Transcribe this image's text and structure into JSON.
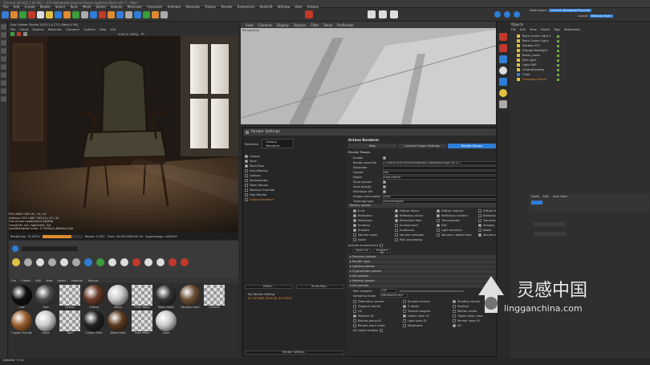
{
  "window": {
    "title": "Cinema 4D S22.118 (RC) - [03 Hollywood Inspired Boom Lighting Start.c4d *] - Main"
  },
  "menus": [
    "File",
    "Edit",
    "Create",
    "Modes",
    "Select",
    "Tools",
    "Mesh",
    "Spline",
    "Volume",
    "MoGraph",
    "Character",
    "Animate",
    "Simulate",
    "Tracker",
    "Render",
    "Extensions",
    "Redshift",
    "Window",
    "Help",
    "Octane"
  ],
  "node_space": {
    "label": "Node Space:",
    "value": "Current (Standard/Physical)",
    "layout_label": "Layout:",
    "layout_value": "Startup (User)"
  },
  "live_viewer": {
    "title": "Live Viewer Studio 2020.1.4 [T.O.-Beta 4 PA]",
    "menus": [
      "File",
      "Cloud",
      "Objects",
      "Materials",
      "Compare",
      "Options",
      "Help",
      "GUI"
    ],
    "zoom": "1:00 (S 100%)",
    "channel": "PT"
  },
  "render_stats": {
    "lines": [
      "RTX 2080 Ti/PCI-E | 74 | 53",
      "GeForce GTX 1080 Ti/PCI-E | 57 | 51",
      "Out-of-core used/max:0 kb/4Gb",
      "Grey8/16: 0/0 | Rgb32/64: 0/4",
      "Used/free/total vram: 4.732Gb/5.464Gb/11Gb"
    ],
    "bar": "Rendering: 73.437% Ms/sec: 5.951 Time: 00 : 00 : 25/00 : 00 : 34 Spp/maxspp: 160/320 Tri: 263/571 Mesh: 1/10 Hair: 0",
    "bar_values": [
      "Rendering: 73.437%",
      "Ms/sec: 5.951",
      "Time: 00:00:25/00:00:34",
      "Spp/maxspp: 160/320"
    ]
  },
  "material_manager": {
    "menus": [
      "File",
      "Create",
      "Edit",
      "View",
      "Select",
      "Material",
      "Texture"
    ],
    "materials": [
      "Leaf",
      "Wall",
      "Octane",
      "Ceiling",
      "Metal",
      "Floor Wood",
      "Black Metal",
      "Wooden Floor",
      "Chrome",
      "Copper Handle",
      "Glass",
      "Wall",
      "Carbon Fiber",
      "Wood Fiber",
      "Floor Metal",
      "Loon"
    ]
  },
  "viewport": {
    "menus": [
      "View",
      "Cameras",
      "Display",
      "Options",
      "Filter",
      "Panel",
      "ProRender"
    ],
    "label": "Perspective"
  },
  "render_settings": {
    "title": "Render Settings",
    "renderer_label": "Renderer",
    "renderer_value": "Octane Renderer",
    "left_items": [
      "Output",
      "Save",
      "Multi-Pass",
      "Anti-Aliasing",
      "Options",
      "Stereoscopic",
      "Team Render",
      "Material Override",
      "Hair Render",
      "Octane Renderer"
    ],
    "effect_button": "Effect...",
    "multipass_button": "Multi-Pass...",
    "preset_items": [
      "My Render Setting",
      "04 OCTANE (RGB 4K GLX PSD)"
    ],
    "render_setting_button": "Render Setting...",
    "heading": "Octane Renderer",
    "tabs": [
      "Main",
      "Camera Imager Settings",
      "Render Passes"
    ],
    "section": "Render Passes",
    "fields": [
      {
        "label": "Enable",
        "checked": true
      },
      {
        "label": "Render pass file",
        "value": "C:\\Users\\Ortiz\\OneDrive\\Desktop\\Cube\\Walkthrough 4K\\ 0\\ 1"
      },
      {
        "label": "Separator",
        "value": ""
      },
      {
        "label": "Format",
        "value": "PNG"
      },
      {
        "label": "Depth",
        "value": "8 bit/Channel"
      },
      {
        "label": "Show passes",
        "checked": true
      },
      {
        "label": "Save beauty",
        "checked": true
      },
      {
        "label": "Multilayer file",
        "checked": true
      },
      {
        "label": "Image color profile",
        "value": "sRGB"
      },
      {
        "label": "Tonemap type",
        "value": "Untonemapped"
      }
    ],
    "subsection": "Beauty passes",
    "beauty_passes": [
      [
        "Emit",
        "Diffuse direct",
        "Diffuse indirect",
        "Diffuse filter"
      ],
      [
        "Reflection",
        "Reflection direct",
        "Reflection indirect",
        "Reflection filter"
      ],
      [
        "Refraction",
        "Refraction filter",
        "Transmission",
        "Transmission filter"
      ],
      [
        "Emitters",
        "Environment",
        "SSS",
        "Shadow"
      ],
      [
        "Shadow",
        "Irradiance",
        "Light direction",
        "Noise"
      ],
      [
        "Volume mask",
        "Volume emission",
        "Volume z-depth front",
        "Volume z-depth back"
      ],
      [
        "Noise",
        "Post processing"
      ]
    ],
    "include_env": "Include environment",
    "select_all": "Select All",
    "deselect_all": "Deselect All",
    "collapsed": [
      "Denoiser passes",
      "Render layer",
      "Lighting passes",
      "Cryptomatte passes",
      "Info passes",
      "Material passes"
    ],
    "info_header": "Info passes",
    "max_samples_label": "Max samples",
    "max_samples_value": "128",
    "sampling_mode_label": "Sampling mode",
    "sampling_mode_value": "Distributed rays",
    "info_passes": [
      [
        "Geometric normal",
        "Smooth normal",
        "Shading normal"
      ],
      [
        "Tangent normal",
        "Z-depth",
        "Position"
      ],
      [
        "UV",
        "Texture tangent",
        "Motion vector"
      ],
      [
        "Material ID",
        "Object layer ID",
        "Object layer color"
      ],
      [
        "Baking group ID",
        "Light pass ID",
        "Render layer ID"
      ],
      [
        "Render layer mask",
        "Wireframe",
        "AO"
      ]
    ],
    "ao_alpha": "AO alpha shadow"
  },
  "objects": {
    "menus": [
      "File",
      "Edit",
      "View",
      "Object",
      "Tags",
      "Bookmarks"
    ],
    "title": "Objects",
    "items": [
      "Back Corner Light 2",
      "Back Corner Light",
      "Window SC7",
      "Orange Backlight",
      "Blank_Lamp",
      "Rim Light",
      "Light GRP",
      "OctaneCamera",
      "Chair",
      "Hollywood Room"
    ]
  },
  "attributes": {
    "title": "Attributes",
    "user_data": "User Data",
    "mode": "Mode",
    "edit": "Edit"
  },
  "statusbar": {
    "text": "Updated: 0 ms"
  },
  "watermark": {
    "cn": "灵感中国",
    "url": "lingganchina.com"
  },
  "colors": {
    "accent": "#2e7dd6",
    "octane_red": "#c03030",
    "orange": "#e08a30",
    "status_green": "#6fae3a"
  }
}
